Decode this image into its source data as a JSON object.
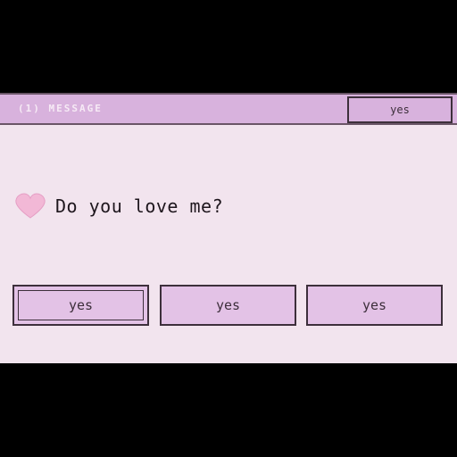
{
  "window": {
    "title": "(1) MESSAGE",
    "titlebar_button_label": "yes"
  },
  "message": {
    "icon": "heart-icon",
    "text": "Do you love me?"
  },
  "buttons": [
    {
      "label": "yes"
    },
    {
      "label": "yes"
    },
    {
      "label": "yes"
    }
  ],
  "colors": {
    "window_bg": "#f2e4ee",
    "titlebar_bg": "#d8b2dd",
    "button_bg": "#e3c2e6",
    "heart": "#f2b8d6",
    "border": "#3d2f3b"
  }
}
